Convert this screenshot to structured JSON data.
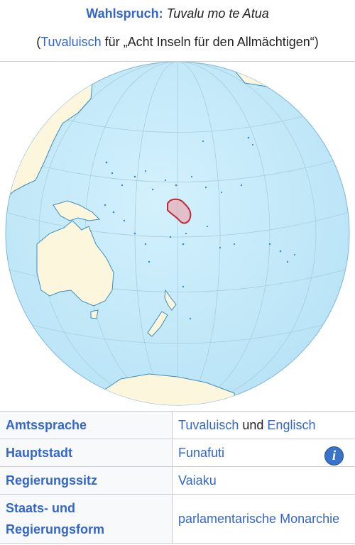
{
  "motto": {
    "label": "Wahlspruch:",
    "text": "Tuvalu mo te Atua",
    "open_paren": "(",
    "language_link": "Tuvaluisch",
    "translation": " für „Acht Inseln für den Allmächtigen“)"
  },
  "map": {
    "info_label": "i",
    "colors": {
      "ocean": "#c6ecfb",
      "land": "#fbf6dc",
      "highlight": "#c12838",
      "coast": "#3b8dbd",
      "graticule": "#a9cddd"
    }
  },
  "facts": [
    {
      "key": "Amtssprache",
      "value_parts": [
        {
          "text": "Tuvaluisch",
          "link": true
        },
        {
          "text": " und ",
          "link": false
        },
        {
          "text": "Englisch",
          "link": true
        }
      ]
    },
    {
      "key": "Hauptstadt",
      "value_parts": [
        {
          "text": "Funafuti",
          "link": true
        }
      ]
    },
    {
      "key": "Regierungssitz",
      "value_parts": [
        {
          "text": "Vaiaku",
          "link": true
        }
      ]
    },
    {
      "key_lines": [
        "Staats- und",
        "Regierungsform"
      ],
      "value_parts": [
        {
          "text": "parlamentarische Monarchie",
          "link": true
        }
      ]
    }
  ]
}
